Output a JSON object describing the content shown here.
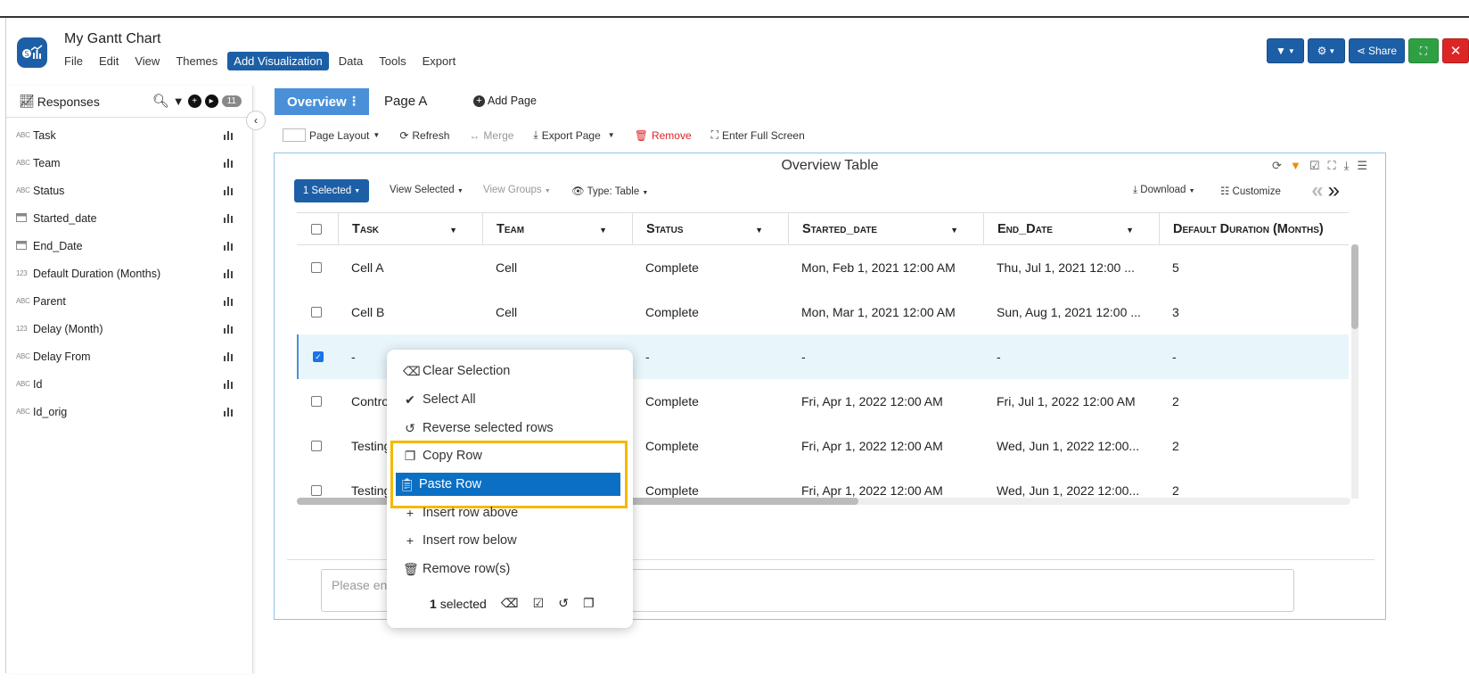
{
  "app": {
    "title": "My Gantt Chart",
    "menu": [
      "File",
      "Edit",
      "View",
      "Themes",
      "Add Visualization",
      "Data",
      "Tools",
      "Export"
    ],
    "active_menu_index": 4,
    "header_buttons": {
      "share": "Share",
      "close": "✕"
    }
  },
  "sidebar": {
    "title": "Responses",
    "badge_count": "11",
    "fields": [
      {
        "type": "ABC",
        "name": "Task"
      },
      {
        "type": "ABC",
        "name": "Team"
      },
      {
        "type": "ABC",
        "name": "Status"
      },
      {
        "type": "date",
        "name": "Started_date"
      },
      {
        "type": "date",
        "name": "End_Date"
      },
      {
        "type": "123",
        "name": "Default Duration (Months)"
      },
      {
        "type": "ABC",
        "name": "Parent"
      },
      {
        "type": "123",
        "name": "Delay (Month)"
      },
      {
        "type": "ABC",
        "name": "Delay From"
      },
      {
        "type": "ABC",
        "name": "Id"
      },
      {
        "type": "ABC",
        "name": "Id_orig"
      }
    ]
  },
  "tabs": {
    "overview": "Overview",
    "page_a": "Page A",
    "add_page": "Add Page"
  },
  "toolbar": {
    "page_layout": "Page Layout",
    "refresh": "Refresh",
    "merge": "Merge",
    "export_page": "Export Page",
    "remove": "Remove",
    "full_screen": "Enter Full Screen"
  },
  "panel": {
    "title": "Overview Table",
    "selected_button": "1 Selected",
    "view_selected": "View Selected",
    "view_groups": "View Groups",
    "type": "Type: Table",
    "download": "Download",
    "customize": "Customize",
    "note_placeholder": "Please enter"
  },
  "table": {
    "columns": [
      "Task",
      "Team",
      "Status",
      "Started_date",
      "End_Date",
      "Default Duration (Months)"
    ],
    "rows": [
      {
        "checked": false,
        "cells": [
          "Cell A",
          "Cell",
          "Complete",
          "Mon, Feb 1, 2021 12:00 AM",
          "Thu, Jul 1, 2021 12:00 ...",
          "5"
        ]
      },
      {
        "checked": false,
        "cells": [
          "Cell B",
          "Cell",
          "Complete",
          "Mon, Mar 1, 2021 12:00 AM",
          "Sun, Aug 1, 2021 12:00 ...",
          "3"
        ]
      },
      {
        "checked": true,
        "cells": [
          "-",
          "",
          "-",
          "-",
          "-",
          "-"
        ]
      },
      {
        "checked": false,
        "cells": [
          "Control",
          "",
          "Complete",
          "Fri, Apr 1, 2022 12:00 AM",
          "Fri, Jul 1, 2022 12:00 AM",
          "2"
        ]
      },
      {
        "checked": false,
        "cells": [
          "Testing",
          "",
          "Complete",
          "Fri, Apr 1, 2022 12:00 AM",
          "Wed, Jun 1, 2022 12:00...",
          "2"
        ]
      },
      {
        "checked": false,
        "cells": [
          "Testing",
          "",
          "Complete",
          "Fri, Apr 1, 2022 12:00 AM",
          "Wed, Jun 1, 2022 12:00...",
          "2"
        ]
      }
    ]
  },
  "context_menu": {
    "items": [
      "Clear Selection",
      "Select All",
      "Reverse selected rows",
      "Copy Row",
      "Paste Row",
      "Insert row above",
      "Insert row below",
      "Remove row(s)"
    ],
    "highlighted_index": 4,
    "footer_count": "1",
    "footer_label": "selected"
  },
  "colors": {
    "accent": "#1d5fa6",
    "highlight_box": "#f5b800",
    "menu_highlight": "#0b6fc4",
    "remove": "#dc2626"
  }
}
